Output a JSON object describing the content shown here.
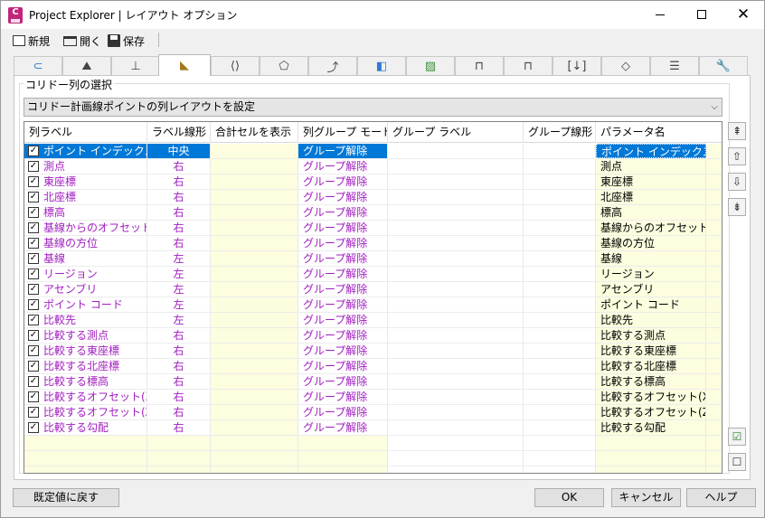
{
  "window": {
    "title": "Project Explorer | レイアウト オプション"
  },
  "toolbar": {
    "new_label": "新規",
    "open_label": "開く",
    "save_label": "保存"
  },
  "tabs": [
    {
      "icon": "alignment-icon"
    },
    {
      "icon": "profile-icon"
    },
    {
      "icon": "section-icon"
    },
    {
      "icon": "corridor-icon",
      "active": true
    },
    {
      "icon": "assembly-icon"
    },
    {
      "icon": "surface-icon"
    },
    {
      "icon": "pipe-icon"
    },
    {
      "icon": "structure-icon"
    },
    {
      "icon": "parcel-icon"
    },
    {
      "icon": "point-group-icon"
    },
    {
      "icon": "pressure-icon"
    },
    {
      "icon": "fitting-icon"
    },
    {
      "icon": "sheet-icon"
    },
    {
      "icon": "report-icon"
    },
    {
      "icon": "settings-icon"
    }
  ],
  "group": {
    "label": "コリドー列の選択"
  },
  "dropdown": {
    "value": "コリドー計画線ポイントの列レイアウトを設定"
  },
  "grid": {
    "headers": [
      "列ラベル",
      "ラベル線形",
      "合計セルを表示",
      "列グループ モード",
      "グループ ラベル",
      "グループ線形",
      "パラメータ名"
    ],
    "rows": [
      {
        "label": "ポイント インデックス",
        "linetype": "中央",
        "mode": "グループ解除",
        "param": "ポイント インデックス",
        "selected": true
      },
      {
        "label": "測点",
        "linetype": "右",
        "mode": "グループ解除",
        "param": "測点"
      },
      {
        "label": "東座標",
        "linetype": "右",
        "mode": "グループ解除",
        "param": "東座標"
      },
      {
        "label": "北座標",
        "linetype": "右",
        "mode": "グループ解除",
        "param": "北座標"
      },
      {
        "label": "標高",
        "linetype": "右",
        "mode": "グループ解除",
        "param": "標高"
      },
      {
        "label": "基線からのオフセット",
        "linetype": "右",
        "mode": "グループ解除",
        "param": "基線からのオフセット"
      },
      {
        "label": "基線の方位",
        "linetype": "右",
        "mode": "グループ解除",
        "param": "基線の方位"
      },
      {
        "label": "基線",
        "linetype": "左",
        "mode": "グループ解除",
        "param": "基線"
      },
      {
        "label": "リージョン",
        "linetype": "左",
        "mode": "グループ解除",
        "param": "リージョン"
      },
      {
        "label": "アセンブリ",
        "linetype": "左",
        "mode": "グループ解除",
        "param": "アセンブリ"
      },
      {
        "label": "ポイント コード",
        "linetype": "左",
        "mode": "グループ解除",
        "param": "ポイント コード"
      },
      {
        "label": "比較先",
        "linetype": "左",
        "mode": "グループ解除",
        "param": "比較先"
      },
      {
        "label": "比較する測点",
        "linetype": "右",
        "mode": "グループ解除",
        "param": "比較する測点"
      },
      {
        "label": "比較する東座標",
        "linetype": "右",
        "mode": "グループ解除",
        "param": "比較する東座標"
      },
      {
        "label": "比較する北座標",
        "linetype": "右",
        "mode": "グループ解除",
        "param": "比較する北座標"
      },
      {
        "label": "比較する標高",
        "linetype": "右",
        "mode": "グループ解除",
        "param": "比較する標高"
      },
      {
        "label": "比較するオフセット(XY)",
        "linetype": "右",
        "mode": "グループ解除",
        "param": "比較するオフセット(XY)"
      },
      {
        "label": "比較するオフセット(Z)",
        "linetype": "右",
        "mode": "グループ解除",
        "param": "比較するオフセット(Z)"
      },
      {
        "label": "比較する勾配",
        "linetype": "右",
        "mode": "グループ解除",
        "param": "比較する勾配"
      }
    ],
    "empty_rows": 3
  },
  "buttons": {
    "reset": "既定値に戻す",
    "ok": "OK",
    "cancel": "キャンセル",
    "help": "ヘルプ"
  },
  "colors": {
    "label_text": "#a11fbf",
    "selection": "#0078d7",
    "yellow_cell": "#fdfddf"
  }
}
